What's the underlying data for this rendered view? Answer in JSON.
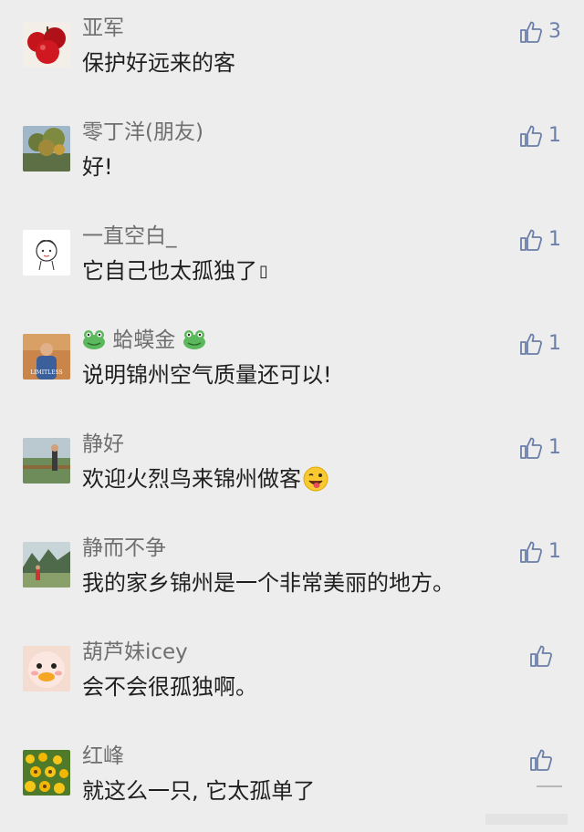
{
  "comments": [
    {
      "name": "亚军",
      "text": "保护好远来的客",
      "likes": "3"
    },
    {
      "name": "零丁洋(朋友)",
      "text": "好!",
      "likes": "1"
    },
    {
      "name": "一直空白_",
      "text": "它自己也太孤独了",
      "likes": "1",
      "trailing_glyph": "▯"
    },
    {
      "name_prefix_icon": "frog-icon",
      "name": "蛤蟆金",
      "name_suffix_icon": "frog-icon",
      "text": "说明锦州空气质量还可以!",
      "likes": "1",
      "avatar_caption": "LIMITLESS"
    },
    {
      "name": "静好",
      "text": "欢迎火烈鸟来锦州做客",
      "text_emoji": "winking-tongue-face-icon",
      "likes": "1"
    },
    {
      "name": "静而不争",
      "text": "我的家乡锦州是一个非常美丽的地方。",
      "likes": "1"
    },
    {
      "name": "葫芦妹icey",
      "text": "会不会很孤独啊。",
      "likes": ""
    },
    {
      "name": "红峰",
      "text": "就这么一只, 它太孤单了",
      "likes": ""
    }
  ],
  "colors": {
    "background": "#ededed",
    "name": "#6f6f6f",
    "text": "#1f1f1f",
    "like": "#6b7fa8"
  }
}
